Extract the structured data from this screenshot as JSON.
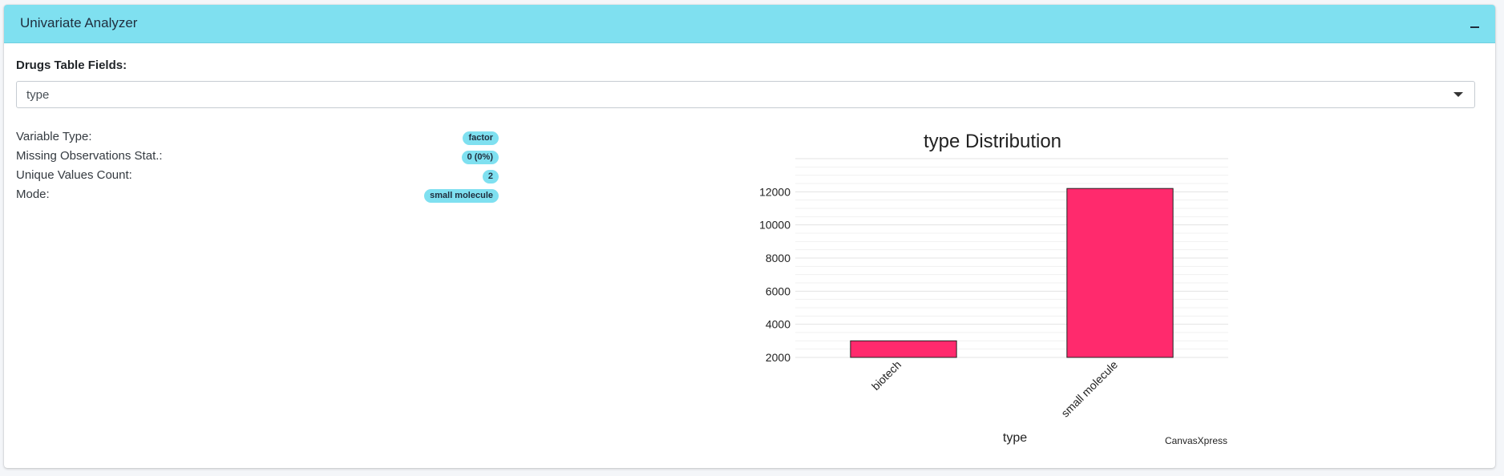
{
  "panel": {
    "title": "Univariate Analyzer",
    "collapse_icon": "minus-icon"
  },
  "field_select": {
    "label": "Drugs Table Fields:",
    "value": "type",
    "caret_icon": "caret-down-icon"
  },
  "stats": [
    {
      "label": "Variable Type:",
      "value": "factor"
    },
    {
      "label": "Missing Observations Stat.:",
      "value": "0 (0%)"
    },
    {
      "label": "Unique Values Count:",
      "value": "2"
    },
    {
      "label": "Mode:",
      "value": "small molecule"
    }
  ],
  "colors": {
    "accent": "#7fe0f0",
    "bar": "#ff2a6d"
  },
  "chart_data": {
    "type": "bar",
    "title": "type Distribution",
    "xlabel": "type",
    "ylabel": "",
    "categories": [
      "biotech",
      "small molecule"
    ],
    "values": [
      3000,
      12200
    ],
    "yticks": [
      "2000",
      "4000",
      "6000",
      "8000",
      "10000",
      "12000"
    ],
    "ylim": [
      2000,
      14000
    ],
    "grid": true,
    "credit": "CanvasXpress"
  }
}
